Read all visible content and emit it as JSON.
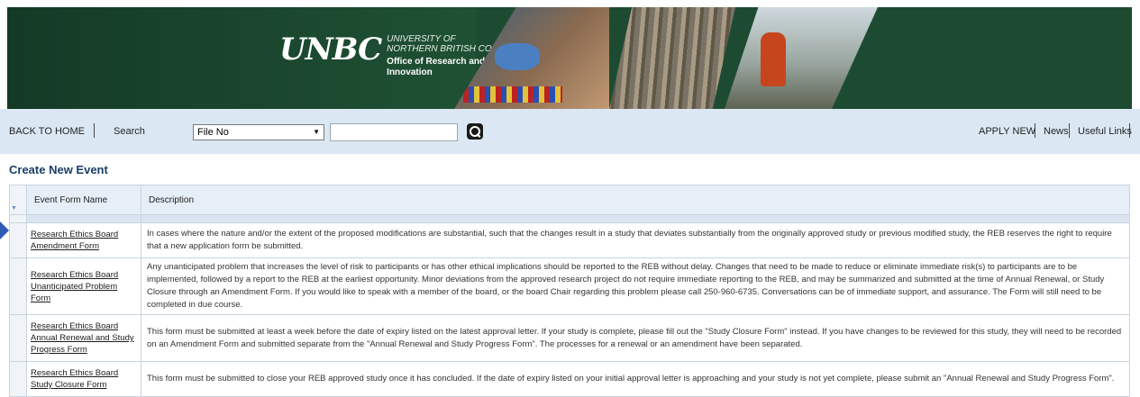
{
  "banner": {
    "logo_mark": "UNBC",
    "university_line1": "UNIVERSITY OF",
    "university_line2": "NORTHERN BRITISH COLUMBIA",
    "office": "Office of Research and Innovation"
  },
  "nav": {
    "back_home": "BACK TO HOME",
    "search_label": "Search",
    "search_field_select": "File No",
    "search_input_value": "",
    "apply_new": "APPLY NEW",
    "news": "News",
    "useful_links": "Useful Links"
  },
  "page": {
    "title": "Create New Event"
  },
  "table": {
    "headers": {
      "name": "Event Form Name",
      "description": "Description"
    },
    "rows": [
      {
        "name": "Research Ethics Board Amendment Form",
        "description": "In cases where the nature and/or the extent of the proposed modifications are substantial, such that the changes result in a study that deviates substantially from the originally approved study or previous modified study, the REB reserves the right to require that a new application form be submitted."
      },
      {
        "name": "Research Ethics Board Unanticipated Problem Form",
        "description": "Any unanticipated problem that increases the level of risk to participants or has other ethical implications should be reported to the REB without delay. Changes that need to be made to reduce or eliminate immediate risk(s) to participants are to be implemented, followed by a report to the REB at the earliest opportunity. Minor deviations from the approved research project do not require immediate reporting to the REB, and may be summarized and submitted at the time of Annual Renewal, or Study Closure through an Amendment Form. If you would like to speak with a member of the board, or the board Chair regarding this problem please call 250-960-6735. Conversations can be of immediate support, and assurance. The Form will still need to be completed in due course."
      },
      {
        "name": "Research Ethics Board Annual Renewal and Study Progress Form",
        "description": "This form must be submitted at least a week before the date of expiry listed on the latest approval letter. If your study is complete, please fill out the \"Study Closure Form\" instead. If you have changes to be reviewed for this study, they will need to be recorded on an Amendment Form and submitted separate from the \"Annual Renewal and Study Progress Form\". The processes for a renewal or an amendment have been separated."
      },
      {
        "name": "Research Ethics Board Study Closure Form",
        "description": "This form must be submitted to close your REB approved study once it has concluded. If the date of expiry listed on your initial approval letter is approaching and your study is not yet complete, please submit an \"Annual Renewal and Study Progress Form\"."
      }
    ]
  },
  "icons": {
    "search_button": "search-icon",
    "expand": "triangle-down-icon",
    "pointer": "arrow-right-icon"
  },
  "colors": {
    "banner_green": "#1d4b32",
    "nav_bg": "#dbe8f4",
    "title_blue": "#1b3f68"
  }
}
